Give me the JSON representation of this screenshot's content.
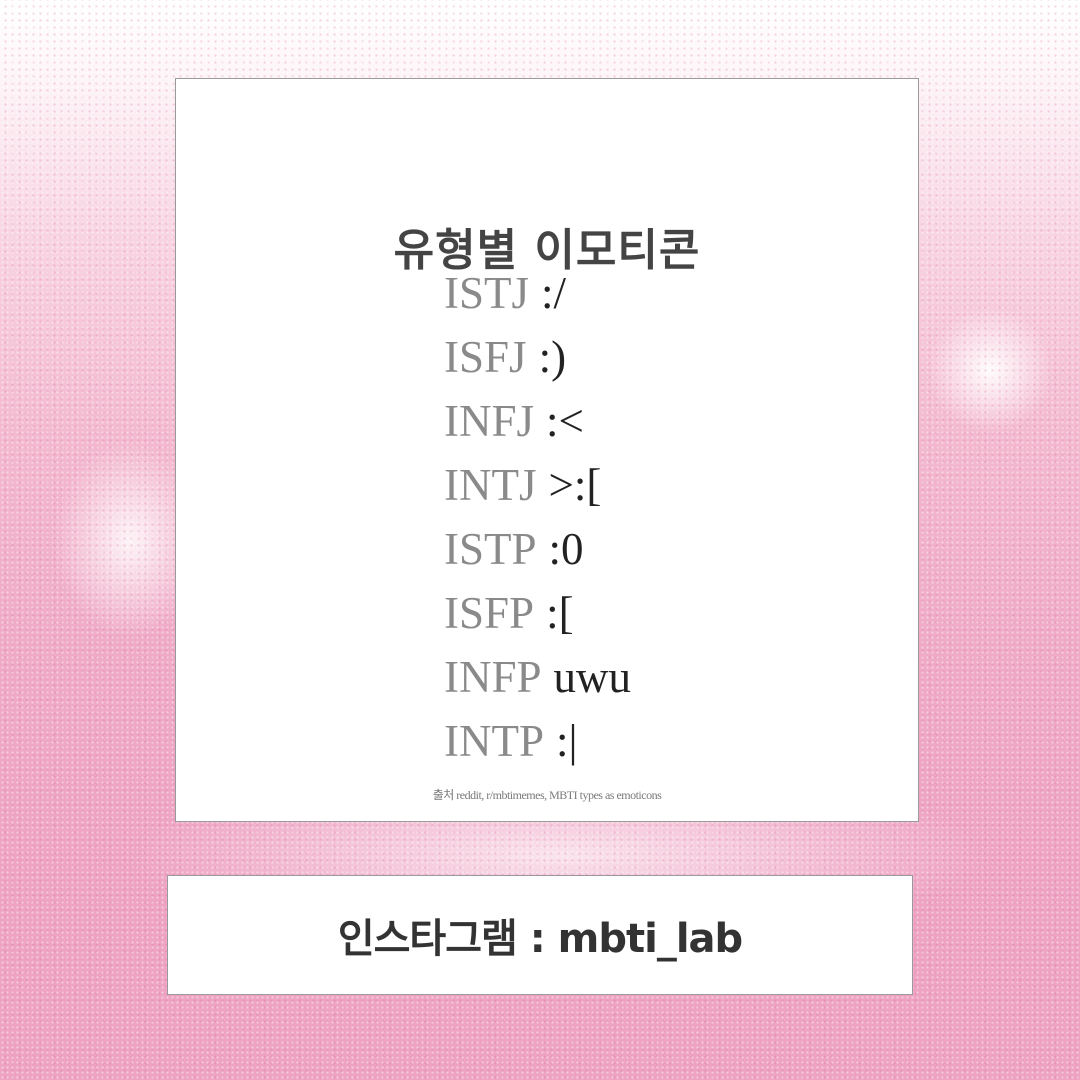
{
  "card": {
    "title": "유형별 이모티콘",
    "items": [
      {
        "type": "ISTJ",
        "emoticon": ":/"
      },
      {
        "type": "ISFJ",
        "emoticon": ":)"
      },
      {
        "type": "INFJ",
        "emoticon": ":<"
      },
      {
        "type": "INTJ",
        "emoticon": ">:["
      },
      {
        "type": "ISTP",
        "emoticon": ":0"
      },
      {
        "type": "ISFP",
        "emoticon": ":["
      },
      {
        "type": "INFP",
        "emoticon": "uwu"
      },
      {
        "type": "INTP",
        "emoticon": ":|"
      }
    ],
    "source": "출처 reddit, r/mbtimemes, MBTI types as emoticons"
  },
  "footer": {
    "text": "인스타그램 : mbti_lab"
  },
  "colors": {
    "background": "#efaac6",
    "card": "#ffffff",
    "type_text": "#8a8a8a",
    "emoticon_text": "#222222",
    "title_text": "#444444"
  }
}
